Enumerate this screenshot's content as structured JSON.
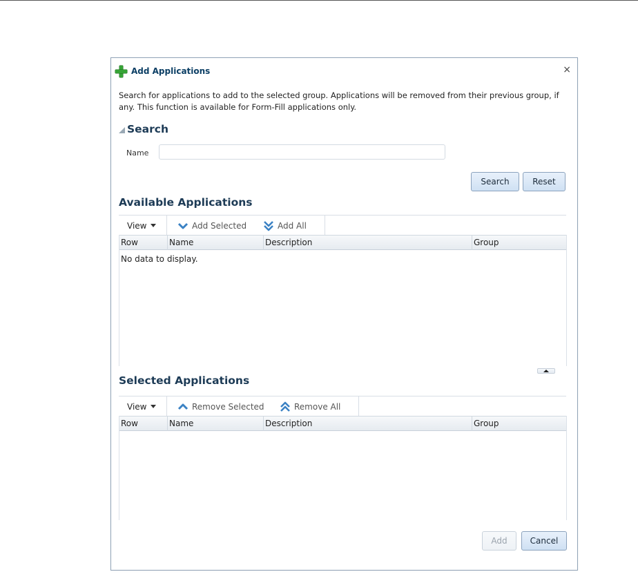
{
  "dialog": {
    "title": "Add Applications",
    "close_glyph": "×",
    "description": "Search for applications to add to the selected group. Applications will be removed from their previous group, if any. This function is available for Form-Fill applications only."
  },
  "search": {
    "heading": "Search",
    "name_label": "Name",
    "name_value": "",
    "search_button": "Search",
    "reset_button": "Reset"
  },
  "available": {
    "heading": "Available Applications",
    "toolbar": {
      "view": "View",
      "add_selected": "Add Selected",
      "add_all": "Add All"
    },
    "columns": [
      "Row",
      "Name",
      "Description",
      "Group"
    ],
    "empty_message": "No data to display."
  },
  "selected": {
    "heading": "Selected Applications",
    "toolbar": {
      "view": "View",
      "remove_selected": "Remove Selected",
      "remove_all": "Remove All"
    },
    "columns": [
      "Row",
      "Name",
      "Description",
      "Group"
    ]
  },
  "footer": {
    "add_button": "Add",
    "cancel_button": "Cancel"
  },
  "colors": {
    "title": "#0c3f65",
    "heading": "#1d3b56",
    "plus_icon": "#36a336",
    "chevron_icon": "#3b82c4"
  },
  "icons": [
    "plus-icon",
    "close-icon",
    "collapse-triangle-icon",
    "chevron-down-icon",
    "double-chevron-down-icon",
    "chevron-up-icon",
    "double-chevron-up-icon",
    "caret-down-icon"
  ]
}
